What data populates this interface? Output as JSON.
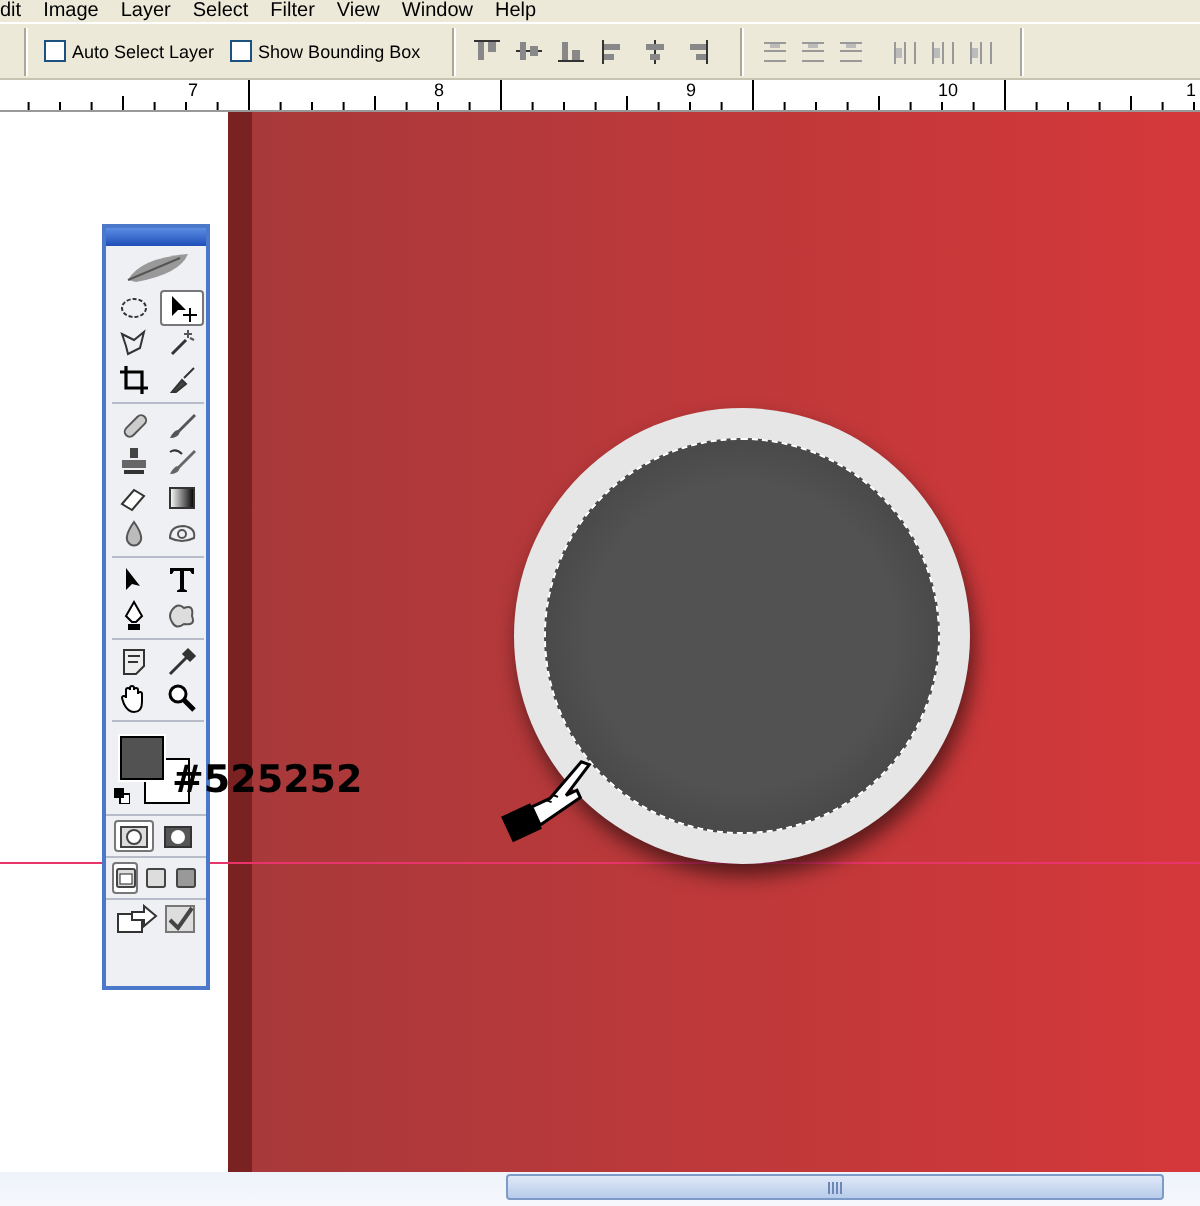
{
  "menu": [
    {
      "label": "dit"
    },
    {
      "label": "Image"
    },
    {
      "label": "Layer"
    },
    {
      "label": "Select"
    },
    {
      "label": "Filter"
    },
    {
      "label": "View"
    },
    {
      "label": "Window"
    },
    {
      "label": "Help"
    }
  ],
  "options": {
    "checkboxes": [
      {
        "label": "Auto Select Layer",
        "checked": false
      },
      {
        "label": "Show Bounding Box",
        "checked": false
      }
    ]
  },
  "ruler": {
    "labels": [
      "7",
      "8",
      "9",
      "10",
      "1"
    ]
  },
  "toolbox": {
    "tools": [
      {
        "selected": false
      },
      {
        "selected": true
      },
      {
        "selected": false
      },
      {
        "selected": false
      },
      {
        "selected": false
      },
      {
        "selected": false
      },
      {
        "selected": false
      },
      {
        "selected": false
      },
      {
        "selected": false
      },
      {
        "selected": false
      },
      {
        "selected": false
      },
      {
        "selected": false
      },
      {
        "selected": false
      },
      {
        "selected": false
      },
      {
        "selected": false
      },
      {
        "selected": false
      },
      {
        "selected": false
      },
      {
        "selected": false
      },
      {
        "selected": false
      },
      {
        "selected": false
      },
      {
        "selected": false
      },
      {
        "selected": false
      }
    ],
    "mask_modes": [
      {
        "selected": true
      },
      {
        "selected": false
      }
    ],
    "screen_modes": [
      {
        "selected": true
      },
      {
        "selected": false
      },
      {
        "selected": false
      }
    ]
  },
  "annotation": "#525252"
}
